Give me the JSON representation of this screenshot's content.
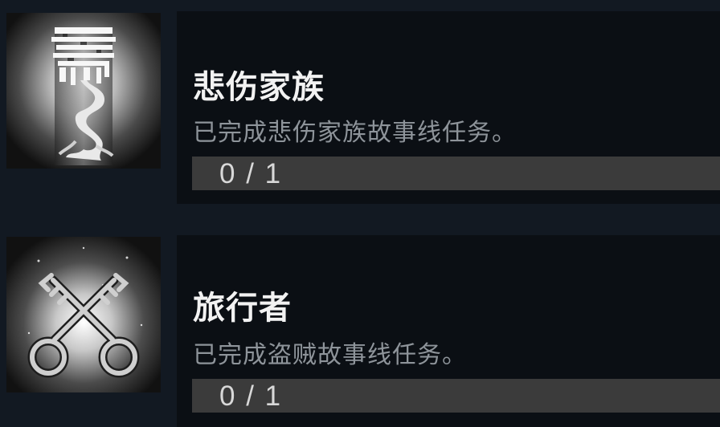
{
  "achievements": [
    {
      "icon": "family-tree-icon",
      "title": "悲伤家族",
      "description": "已完成悲伤家族故事线任务。",
      "progress_text": "0 / 1",
      "progress_fraction": 0
    },
    {
      "icon": "crossed-keys-icon",
      "title": "旅行者",
      "description": "已完成盗贼故事线任务。",
      "progress_text": "0 / 1",
      "progress_fraction": 0
    }
  ]
}
